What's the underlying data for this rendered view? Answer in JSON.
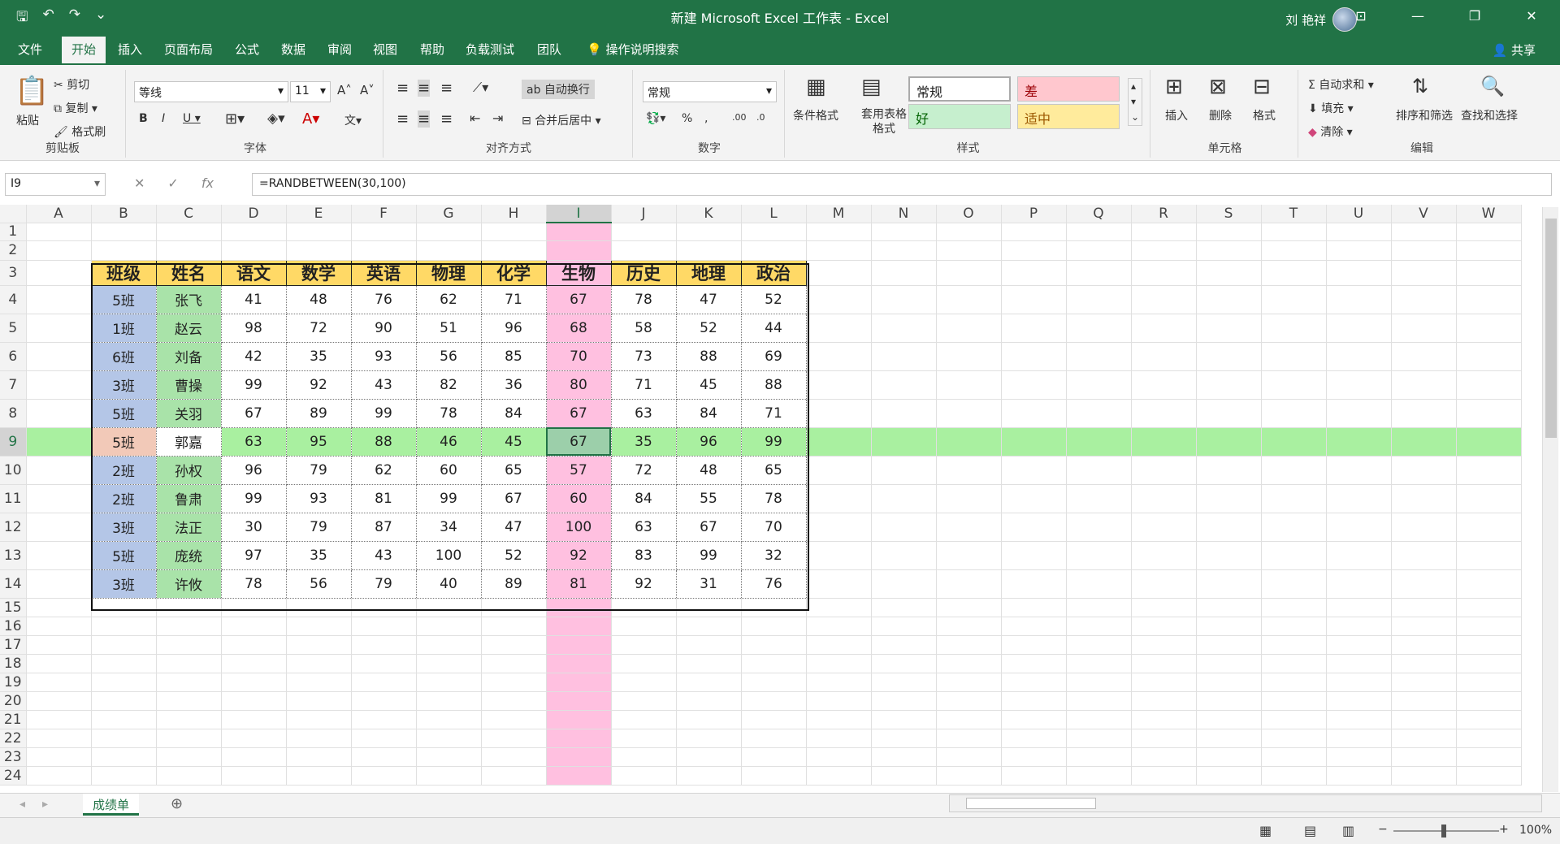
{
  "window": {
    "title": "新建 Microsoft Excel 工作表 - Excel",
    "user": "刘 艳祥"
  },
  "qat": {
    "save_icon": "save-icon",
    "undo_icon": "undo-icon",
    "redo_icon": "redo-icon"
  },
  "tabs": [
    "文件",
    "开始",
    "插入",
    "页面布局",
    "公式",
    "数据",
    "审阅",
    "视图",
    "帮助",
    "负载测试",
    "团队",
    "操作说明搜索"
  ],
  "share": "共享",
  "ribbon": {
    "clipboard": {
      "paste": "粘贴",
      "cut": "剪切",
      "copy": "复制",
      "format_painter": "格式刷",
      "label": "剪贴板"
    },
    "font": {
      "name": "等线",
      "size": "11",
      "label": "字体"
    },
    "align": {
      "wrap": "自动换行",
      "merge": "合并后居中",
      "label": "对齐方式"
    },
    "number": {
      "format": "常规",
      "label": "数字"
    },
    "styles": {
      "cond": "条件格式",
      "table": "套用表格格式",
      "normal": "常规",
      "bad": "差",
      "good": "好",
      "neutral": "适中",
      "label": "样式"
    },
    "cells": {
      "insert": "插入",
      "delete": "删除",
      "format": "格式",
      "label": "单元格"
    },
    "edit": {
      "autosum": "自动求和",
      "fill": "填充",
      "clear": "清除",
      "sort": "排序和筛选",
      "find": "查找和选择",
      "label": "编辑"
    }
  },
  "formula_bar": {
    "name_box": "I9",
    "formula": "=RANDBETWEEN(30,100)"
  },
  "columns": [
    "A",
    "B",
    "C",
    "D",
    "E",
    "F",
    "G",
    "H",
    "I",
    "J",
    "K",
    "L",
    "M",
    "N",
    "O",
    "P",
    "Q",
    "R",
    "S",
    "T",
    "U",
    "V",
    "W"
  ],
  "rows": [
    "1",
    "2",
    "3",
    "4",
    "5",
    "6",
    "7",
    "8",
    "9",
    "10",
    "11",
    "12",
    "13",
    "14",
    "15",
    "16",
    "17",
    "18",
    "19",
    "20",
    "21",
    "22",
    "23",
    "24"
  ],
  "table": {
    "headers": [
      "班级",
      "姓名",
      "语文",
      "数学",
      "英语",
      "物理",
      "化学",
      "生物",
      "历史",
      "地理",
      "政治"
    ],
    "rows": [
      [
        "5班",
        "张飞",
        "41",
        "48",
        "76",
        "62",
        "71",
        "67",
        "78",
        "47",
        "52"
      ],
      [
        "1班",
        "赵云",
        "98",
        "72",
        "90",
        "51",
        "96",
        "68",
        "58",
        "52",
        "44"
      ],
      [
        "6班",
        "刘备",
        "42",
        "35",
        "93",
        "56",
        "85",
        "70",
        "73",
        "88",
        "69"
      ],
      [
        "3班",
        "曹操",
        "99",
        "92",
        "43",
        "82",
        "36",
        "80",
        "71",
        "45",
        "88"
      ],
      [
        "5班",
        "关羽",
        "67",
        "89",
        "99",
        "78",
        "84",
        "67",
        "63",
        "84",
        "71"
      ],
      [
        "5班",
        "郭嘉",
        "63",
        "95",
        "88",
        "46",
        "45",
        "67",
        "35",
        "96",
        "99"
      ],
      [
        "2班",
        "孙权",
        "96",
        "79",
        "62",
        "60",
        "65",
        "57",
        "72",
        "48",
        "65"
      ],
      [
        "2班",
        "鲁肃",
        "99",
        "93",
        "81",
        "99",
        "67",
        "60",
        "84",
        "55",
        "78"
      ],
      [
        "3班",
        "法正",
        "30",
        "79",
        "87",
        "34",
        "47",
        "100",
        "63",
        "67",
        "70"
      ],
      [
        "5班",
        "庞统",
        "97",
        "35",
        "43",
        "100",
        "52",
        "92",
        "83",
        "99",
        "32"
      ],
      [
        "3班",
        "许攸",
        "78",
        "56",
        "79",
        "40",
        "89",
        "81",
        "92",
        "31",
        "76"
      ]
    ]
  },
  "sheet_tab": "成绩单",
  "zoom": "100%"
}
